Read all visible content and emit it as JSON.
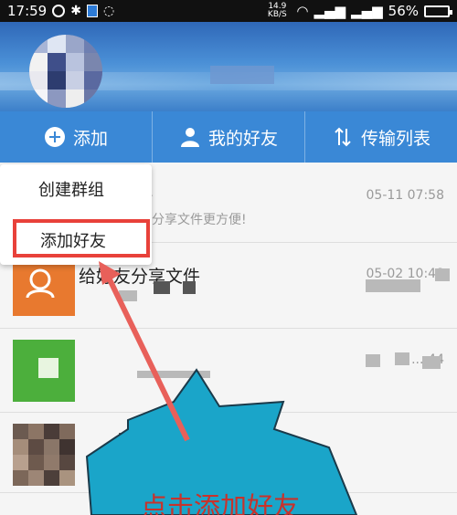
{
  "status_bar": {
    "time": "17:59",
    "speed": "14.9 KB/S",
    "battery": "56%"
  },
  "tabs": [
    {
      "label": "添加",
      "icon": "plus-circle-icon"
    },
    {
      "label": "我的好友",
      "icon": "person-icon"
    },
    {
      "label": "传输列表",
      "icon": "transfer-arrows-icon"
    }
  ],
  "dropdown": {
    "items": [
      "创建群组",
      "添加好友"
    ]
  },
  "list": {
    "rows": [
      {
        "title": "好",
        "subtitle": "分享文件更方便!",
        "time": "05-11 07:58"
      },
      {
        "title": "给好友分享文件",
        "subtitle": "",
        "time": "05-02 10:48"
      },
      {
        "title": "",
        "subtitle": "",
        "time": "...:44"
      },
      {
        "title": "",
        "subtitle": "",
        "time": ""
      }
    ]
  },
  "annotation": {
    "text": "点击添加好友",
    "color": "#c8322b",
    "bubble_color": "#1aa5c9"
  },
  "colors": {
    "tab_blue": "#3a88d6",
    "highlight_red": "#e8413a"
  }
}
